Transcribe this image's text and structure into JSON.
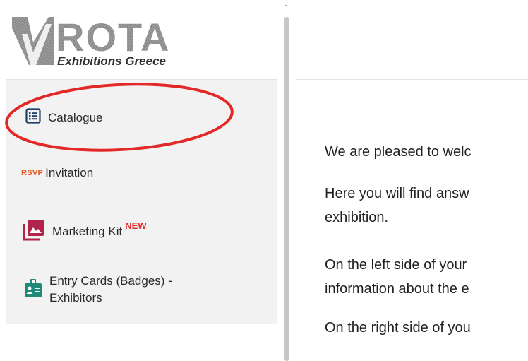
{
  "logo": {
    "brand": "ROTA",
    "subtitle": "Exhibitions Greece"
  },
  "nav": {
    "items": [
      {
        "label": "Catalogue",
        "icon": "list-icon"
      },
      {
        "badge": "RSVP",
        "label": "Invitation"
      },
      {
        "label": "Marketing Kit",
        "tag": "NEW",
        "icon": "image-gallery-icon"
      },
      {
        "label_line1": "Entry Cards (Badges) -",
        "label_line2": "Exhibitors",
        "icon": "badge-icon"
      }
    ]
  },
  "content": {
    "p1": "We are pleased to welc",
    "p2_line1": "Here you will find answ",
    "p2_line2": "exhibition.",
    "p3_line1": "On the left side of your",
    "p3_line2": "information about the e",
    "p4": "On the right side of you"
  },
  "colors": {
    "accent_red": "#e32828",
    "rsvp_orange": "#e8521f",
    "marketing_icon": "#b0234a",
    "badge_icon": "#1f8a7a",
    "list_icon": "#1d3f66"
  }
}
